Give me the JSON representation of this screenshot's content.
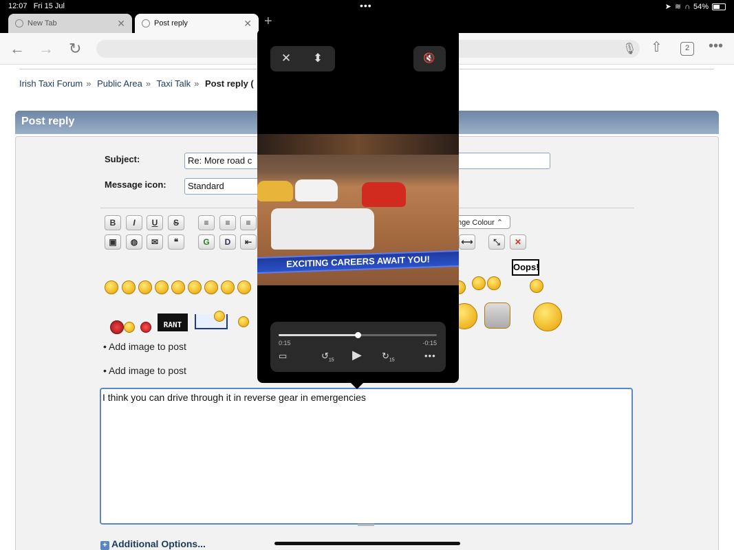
{
  "status_bar": {
    "time": "12:07",
    "date": "Fri 15 Jul",
    "battery": "54%",
    "battery_level": 0.54
  },
  "tabs": [
    {
      "label": "New Tab"
    },
    {
      "label": "Post reply"
    }
  ],
  "toolbar": {
    "tab_count": "2"
  },
  "breadcrumb": [
    "Irish Taxi Forum",
    "Public Area",
    "Taxi Talk",
    "Post reply ("
  ],
  "form": {
    "title": "Post reply",
    "subject_label": "Subject:",
    "subject_value": "Re: More road c",
    "message_icon_label": "Message icon:",
    "message_icon_value": "Standard",
    "colour_select": "nge Colour",
    "editor_buttons": [
      "B",
      "I",
      "U",
      "S"
    ],
    "add_image_1": "• Add image to post",
    "add_image_2": "• Add image to post",
    "message": "I think you can drive through it in reverse gear in emergencies",
    "additional_options": "Additional Options...",
    "oops": "Oops!",
    "rant": "RANT"
  },
  "player": {
    "banner": "EXCITING CAREERS AWAIT YOU!",
    "elapsed": "0:15",
    "remaining": "-0:15",
    "progress": 0.5,
    "skip_back": "15",
    "skip_forward": "15"
  }
}
